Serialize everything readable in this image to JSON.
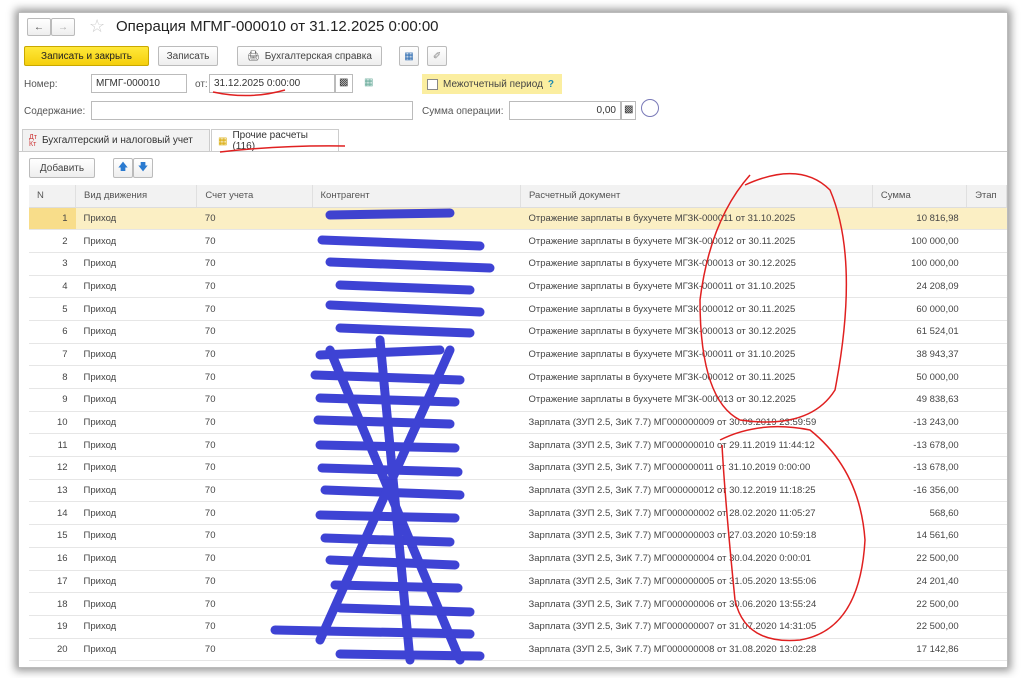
{
  "title": "Операция МГМГ-000010 от 31.12.2025 0:00:00",
  "toolbar": {
    "save_close": "Записать и закрыть",
    "save": "Записать",
    "report": "Бухгалтерская справка"
  },
  "form": {
    "number_label": "Номер:",
    "number": "МГМГ-000010",
    "date_label": "от:",
    "date": "31.12.2025  0:00:00",
    "interperiod": "Межотчетный период",
    "help": "?",
    "content_label": "Содержание:",
    "content": "",
    "sum_label": "Сумма операции:",
    "sum": "0,00"
  },
  "tabs": [
    {
      "label": "Бухгалтерский и налоговый учет",
      "icon": "dt-kt-icon"
    },
    {
      "label": "Прочие расчеты (116)",
      "icon": "document-icon"
    }
  ],
  "table_toolbar": {
    "add": "Добавить"
  },
  "columns": [
    "N",
    "Вид движения",
    "Счет учета",
    "Контрагент",
    "Расчетный документ",
    "Сумма",
    "Этап"
  ],
  "rows": [
    [
      "1",
      "Приход",
      "70",
      "",
      "Отражение зарплаты в бухучете МГЗК-000011 от 31.10.2025",
      "10 816,98"
    ],
    [
      "2",
      "Приход",
      "70",
      "",
      "Отражение зарплаты в бухучете МГЗК-000012 от 30.11.2025",
      "100 000,00"
    ],
    [
      "3",
      "Приход",
      "70",
      "",
      "Отражение зарплаты в бухучете МГЗК-000013 от 30.12.2025",
      "100 000,00"
    ],
    [
      "4",
      "Приход",
      "70",
      "",
      "Отражение зарплаты в бухучете МГЗК-000011 от 31.10.2025",
      "24 208,09"
    ],
    [
      "5",
      "Приход",
      "70",
      "",
      "Отражение зарплаты в бухучете МГЗК-000012 от 30.11.2025",
      "60 000,00"
    ],
    [
      "6",
      "Приход",
      "70",
      "",
      "Отражение зарплаты в бухучете МГЗК-000013 от 30.12.2025",
      "61 524,01"
    ],
    [
      "7",
      "Приход",
      "70",
      "",
      "Отражение зарплаты в бухучете МГЗК-000011 от 31.10.2025",
      "38 943,37"
    ],
    [
      "8",
      "Приход",
      "70",
      "",
      "Отражение зарплаты в бухучете МГЗК-000012 от 30.11.2025",
      "50 000,00"
    ],
    [
      "9",
      "Приход",
      "70",
      "",
      "Отражение зарплаты в бухучете МГЗК-000013 от 30.12.2025",
      "49 838,63"
    ],
    [
      "10",
      "Приход",
      "70",
      "",
      "Зарплата (ЗУП 2.5, ЗиК 7.7) МГ000000009 от 30.09.2019 23:59:59",
      "-13 243,00"
    ],
    [
      "11",
      "Приход",
      "70",
      "",
      "Зарплата (ЗУП 2.5, ЗиК 7.7) МГ000000010 от 29.11.2019 11:44:12",
      "-13 678,00"
    ],
    [
      "12",
      "Приход",
      "70",
      "",
      "Зарплата (ЗУП 2.5, ЗиК 7.7) МГ000000011 от 31.10.2019 0:00:00",
      "-13 678,00"
    ],
    [
      "13",
      "Приход",
      "70",
      "",
      "Зарплата (ЗУП 2.5, ЗиК 7.7) МГ000000012 от 30.12.2019 11:18:25",
      "-16 356,00"
    ],
    [
      "14",
      "Приход",
      "70",
      "",
      "Зарплата (ЗУП 2.5, ЗиК 7.7) МГ000000002 от 28.02.2020 11:05:27",
      "568,60"
    ],
    [
      "15",
      "Приход",
      "70",
      "",
      "Зарплата (ЗУП 2.5, ЗиК 7.7) МГ000000003 от 27.03.2020 10:59:18",
      "14 561,60"
    ],
    [
      "16",
      "Приход",
      "70",
      "",
      "Зарплата (ЗУП 2.5, ЗиК 7.7) МГ000000004 от 30.04.2020 0:00:01",
      "22 500,00"
    ],
    [
      "17",
      "Приход",
      "70",
      "",
      "Зарплата (ЗУП 2.5, ЗиК 7.7) МГ000000005 от 31.05.2020 13:55:06",
      "24 201,40"
    ],
    [
      "18",
      "Приход",
      "70",
      "",
      "Зарплата (ЗУП 2.5, ЗиК 7.7) МГ000000006 от 30.06.2020 13:55:24",
      "22 500,00"
    ],
    [
      "19",
      "Приход",
      "70",
      "",
      "Зарплата (ЗУП 2.5, ЗиК 7.7) МГ000000007 от 31.07.2020 14:31:05",
      "22 500,00"
    ],
    [
      "20",
      "Приход",
      "70",
      "",
      "Зарплата (ЗУП 2.5, ЗиК 7.7) МГ000000008 от 31.08.2020 13:02:28",
      "17 142,86"
    ]
  ],
  "colors": {
    "primary": "#f5cf0c",
    "selected_row": "#fbefc4",
    "scribble": "#2a2fd0",
    "annotation": "#e02020"
  }
}
